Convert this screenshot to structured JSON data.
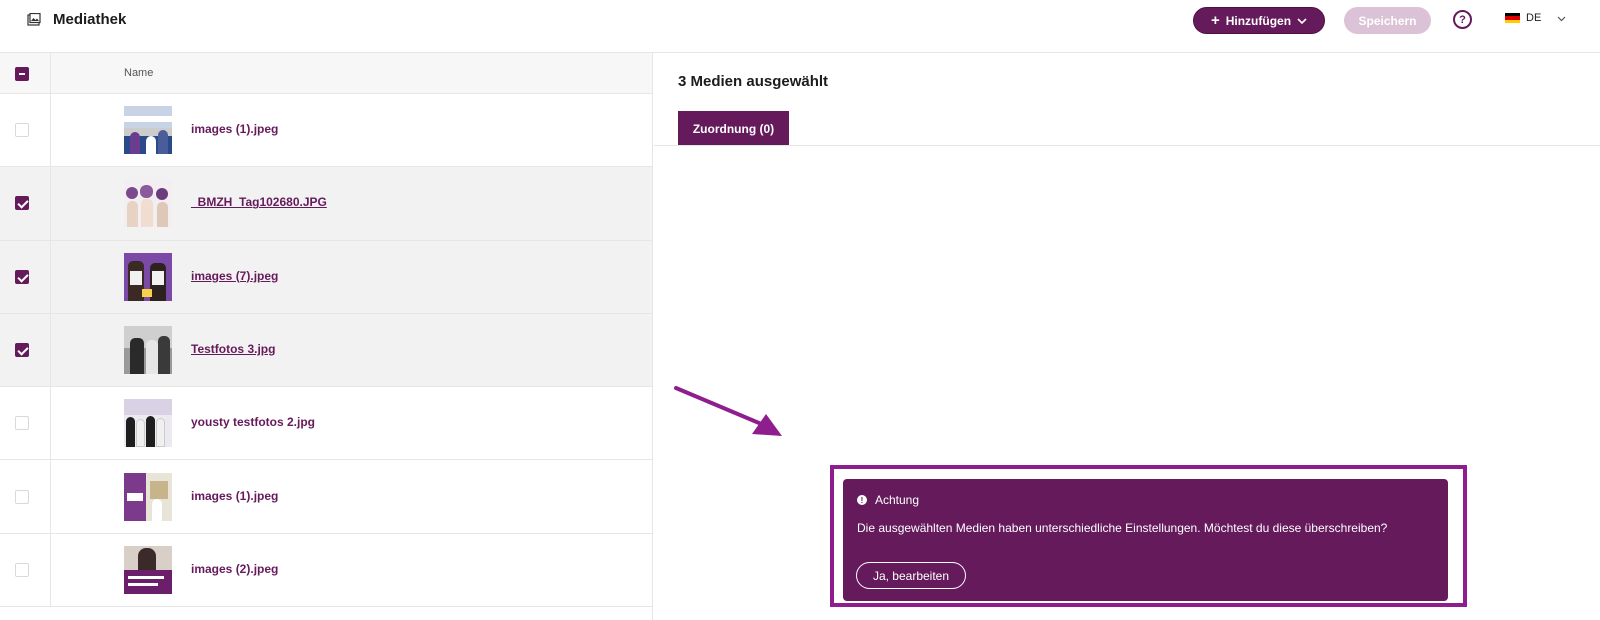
{
  "header": {
    "title": "Mediathek",
    "add_button": "Hinzufügen",
    "save_button": "Speichern",
    "help_icon": "question-circle-icon",
    "language": "DE"
  },
  "table": {
    "column_name": "Name",
    "rows": [
      {
        "name": "images (1).jpeg",
        "checked": false
      },
      {
        "name": "_BMZH_Tag102680.JPG",
        "checked": true
      },
      {
        "name": "images (7).jpeg",
        "checked": true
      },
      {
        "name": "Testfotos 3.jpg",
        "checked": true
      },
      {
        "name": "yousty testfotos 2.jpg",
        "checked": false
      },
      {
        "name": "images (1).jpeg",
        "checked": false
      },
      {
        "name": "images (2).jpeg",
        "checked": false
      }
    ]
  },
  "panel": {
    "title": "3 Medien ausgewählt",
    "tab_label": "Zuordnung (0)"
  },
  "alert": {
    "title": "Achtung",
    "message": "Die ausgewählten Medien haben unterschiedliche Einstellungen. Möchtest du diese überschreiben?",
    "button": "Ja, bearbeiten"
  },
  "colors": {
    "brand": "#651a5b",
    "brand_light": "#dcc2d7",
    "highlight": "#8e1e8e"
  }
}
